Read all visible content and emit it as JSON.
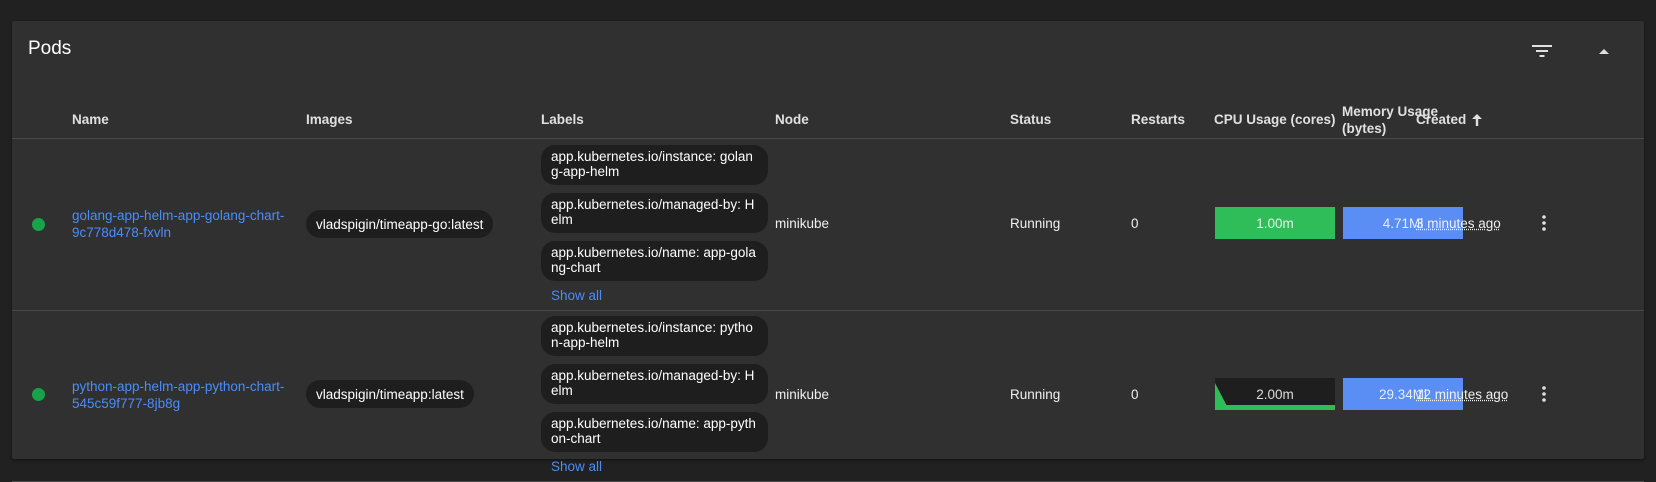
{
  "card": {
    "title": "Pods"
  },
  "header_icons": {
    "filter": "filter-icon",
    "collapse": "collapse-up-icon"
  },
  "columns": {
    "name": "Name",
    "images": "Images",
    "labels": "Labels",
    "node": "Node",
    "status": "Status",
    "restarts": "Restarts",
    "cpu": "CPU Usage (cores)",
    "memory": "Memory Usage (bytes)",
    "created": "Created",
    "sort_icon": "arrow-up-icon"
  },
  "colors": {
    "status_ok": "#18a24a",
    "link": "#4a8df8",
    "cpu": "#2fbd5a",
    "memory": "#5b8ef5"
  },
  "rows": [
    {
      "name": "golang-app-helm-app-golang-chart-9c778d478-fxvln",
      "image": "vladspigin/timeapp-go:latest",
      "labels": [
        "app.kubernetes.io/instance: golang-app-helm",
        "app.kubernetes.io/managed-by: Helm",
        "app.kubernetes.io/name: app-golang-chart"
      ],
      "show_all": "Show all",
      "node": "minikube",
      "status": "Running",
      "restarts": "0",
      "cpu": "1.00m",
      "cpu_fraction": 1.0,
      "memory": "4.71Mi",
      "memory_fraction": 1.0,
      "created": "3 minutes ago"
    },
    {
      "name": "python-app-helm-app-python-chart-545c59f777-8jb8g",
      "image": "vladspigin/timeapp:latest",
      "labels": [
        "app.kubernetes.io/instance: python-app-helm",
        "app.kubernetes.io/managed-by: Helm",
        "app.kubernetes.io/name: app-python-chart"
      ],
      "show_all": "Show all",
      "node": "minikube",
      "status": "Running",
      "restarts": "0",
      "cpu": "2.00m",
      "cpu_fraction": 0.15,
      "memory": "29.34Mi",
      "memory_fraction": 1.0,
      "created": "12 minutes ago"
    }
  ]
}
